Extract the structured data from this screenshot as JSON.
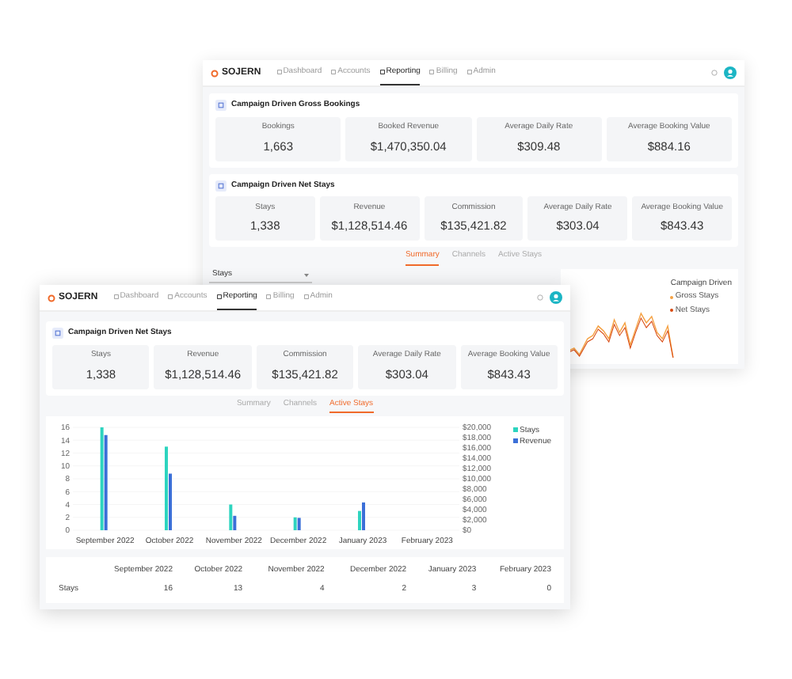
{
  "back_window": {
    "nav": {
      "brand": "SOJERN",
      "items": [
        {
          "label": "Dashboard",
          "selected": false
        },
        {
          "label": "Accounts",
          "selected": false
        },
        {
          "label": "Reporting",
          "selected": true
        },
        {
          "label": "Billing",
          "selected": false
        },
        {
          "label": "Admin",
          "selected": false
        }
      ]
    },
    "cards": [
      {
        "title": "Campaign Driven Gross Bookings",
        "stats": [
          {
            "label": "Bookings",
            "value": "1,663"
          },
          {
            "label": "Booked Revenue",
            "value": "$1,470,350.04"
          },
          {
            "label": "Average Daily Rate",
            "value": "$309.48"
          },
          {
            "label": "Average Booking Value",
            "value": "$884.16"
          }
        ]
      },
      {
        "title": "Campaign Driven Net Stays",
        "stats": [
          {
            "label": "Stays",
            "value": "1,338"
          },
          {
            "label": "Revenue",
            "value": "$1,128,514.46"
          },
          {
            "label": "Commission",
            "value": "$135,421.82"
          },
          {
            "label": "Average Daily Rate",
            "value": "$303.04"
          },
          {
            "label": "Average Booking Value",
            "value": "$843.43"
          }
        ]
      }
    ],
    "tabs": [
      {
        "label": "Summary",
        "selected": true
      },
      {
        "label": "Channels",
        "selected": false
      },
      {
        "label": "Active Stays",
        "selected": false
      }
    ],
    "dropdown": {
      "value": "Stays"
    },
    "line_chart": {
      "legend_title": "Campaign Driven",
      "legend": [
        {
          "label": "Gross Stays",
          "color": "#f5a142"
        },
        {
          "label": "Net Stays",
          "color": "#d9480f"
        }
      ]
    }
  },
  "front_window": {
    "nav": {
      "brand": "SOJERN",
      "items": [
        {
          "label": "Dashboard",
          "selected": false
        },
        {
          "label": "Accounts",
          "selected": false
        },
        {
          "label": "Reporting",
          "selected": true
        },
        {
          "label": "Billing",
          "selected": false
        },
        {
          "label": "Admin",
          "selected": false
        }
      ]
    },
    "card": {
      "title": "Campaign Driven Net Stays",
      "stats": [
        {
          "label": "Stays",
          "value": "1,338"
        },
        {
          "label": "Revenue",
          "value": "$1,128,514.46"
        },
        {
          "label": "Commission",
          "value": "$135,421.82"
        },
        {
          "label": "Average Daily Rate",
          "value": "$303.04"
        },
        {
          "label": "Average Booking Value",
          "value": "$843.43"
        }
      ]
    },
    "tabs": [
      {
        "label": "Summary",
        "selected": false
      },
      {
        "label": "Channels",
        "selected": false
      },
      {
        "label": "Active Stays",
        "selected": true
      }
    ],
    "chart_data": {
      "type": "bar",
      "categories": [
        "September 2022",
        "October 2022",
        "November 2022",
        "December 2022",
        "January 2023",
        "February 2023"
      ],
      "series": [
        {
          "name": "Stays",
          "color": "#2dd4bf",
          "values": [
            16,
            13,
            4,
            2,
            3,
            0
          ]
        },
        {
          "name": "Revenue",
          "color": "#3b6fd8",
          "axis": "y2",
          "values": [
            18500,
            11000,
            2800,
            2400,
            5400,
            0
          ]
        }
      ],
      "ylim": [
        0,
        16
      ],
      "y2lim": [
        0,
        20000
      ],
      "grid": true,
      "legend": "top right",
      "yticks": [
        0,
        2,
        4,
        6,
        8,
        10,
        12,
        14,
        16
      ],
      "y2ticks": [
        {
          "value": 0,
          "label": "$0"
        },
        {
          "value": 2000,
          "label": "$2,000"
        },
        {
          "value": 4000,
          "label": "$4,000"
        },
        {
          "value": 6000,
          "label": "$6,000"
        },
        {
          "value": 8000,
          "label": "$8,000"
        },
        {
          "value": 10000,
          "label": "$10,000"
        },
        {
          "value": 12000,
          "label": "$12,000"
        },
        {
          "value": 14000,
          "label": "$14,000"
        },
        {
          "value": 16000,
          "label": "$16,000"
        },
        {
          "value": 18000,
          "label": "$18,000"
        },
        {
          "value": 20000,
          "label": "$20,000"
        }
      ]
    },
    "table": {
      "columns": [
        "September 2022",
        "October 2022",
        "November 2022",
        "December 2022",
        "January 2023",
        "February 2023"
      ],
      "rows": [
        {
          "label": "Stays",
          "cells": [
            "16",
            "13",
            "4",
            "2",
            "3",
            "0"
          ]
        }
      ]
    }
  }
}
